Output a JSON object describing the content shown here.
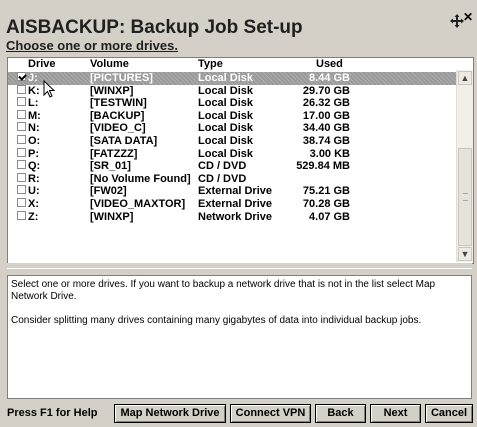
{
  "header": {
    "title": "AISBACKUP: Backup Job Set-up",
    "subtitle": "Choose one or more drives."
  },
  "columns": {
    "drive": "Drive",
    "volume": "Volume",
    "type": "Type",
    "used": "Used"
  },
  "drives": [
    {
      "drive": "J:",
      "volume": "[PICTURES]",
      "type": "Local Disk",
      "used": "8.44 GB",
      "checked": true,
      "selected": true
    },
    {
      "drive": "K:",
      "volume": "[WINXP]",
      "type": "Local Disk",
      "used": "29.70 GB",
      "checked": false,
      "selected": false
    },
    {
      "drive": "L:",
      "volume": "[TESTWIN]",
      "type": "Local Disk",
      "used": "26.32 GB",
      "checked": false,
      "selected": false
    },
    {
      "drive": "M:",
      "volume": "[BACKUP]",
      "type": "Local Disk",
      "used": "17.00 GB",
      "checked": false,
      "selected": false
    },
    {
      "drive": "N:",
      "volume": "[VIDEO_C]",
      "type": "Local Disk",
      "used": "34.40 GB",
      "checked": false,
      "selected": false
    },
    {
      "drive": "O:",
      "volume": "[SATA DATA]",
      "type": "Local Disk",
      "used": "38.74 GB",
      "checked": false,
      "selected": false
    },
    {
      "drive": "P:",
      "volume": "[FATZZZ]",
      "type": "Local Disk",
      "used": "3.00 KB",
      "checked": false,
      "selected": false
    },
    {
      "drive": "Q:",
      "volume": "[SR_01]",
      "type": "CD / DVD",
      "used": "529.84 MB",
      "checked": false,
      "selected": false
    },
    {
      "drive": "R:",
      "volume": "[No Volume Found]",
      "type": "CD / DVD",
      "used": "",
      "checked": false,
      "selected": false
    },
    {
      "drive": "U:",
      "volume": "[FW02]",
      "type": "External Drive",
      "used": "75.21 GB",
      "checked": false,
      "selected": false
    },
    {
      "drive": "X:",
      "volume": "[VIDEO_MAXTOR]",
      "type": "External Drive",
      "used": "70.28 GB",
      "checked": false,
      "selected": false
    },
    {
      "drive": "Z:",
      "volume": "[WINXP]",
      "type": "Network Drive",
      "used": "4.07 GB",
      "checked": false,
      "selected": false
    }
  ],
  "info": {
    "line1": "Select one or more drives. If you want to backup a network drive that is not in the list select Map Network Drive.",
    "line2": "Consider splitting many drives containing many gigabytes of data into individual backup jobs."
  },
  "footer": {
    "help": "Press F1 for Help",
    "map_network_drive": "Map Network Drive",
    "connect_vpn": "Connect VPN",
    "back": "Back",
    "next": "Next",
    "cancel": "Cancel"
  },
  "icons": {
    "move": "move-icon",
    "close": "close-icon",
    "cursor": "arrow-cursor-icon"
  }
}
